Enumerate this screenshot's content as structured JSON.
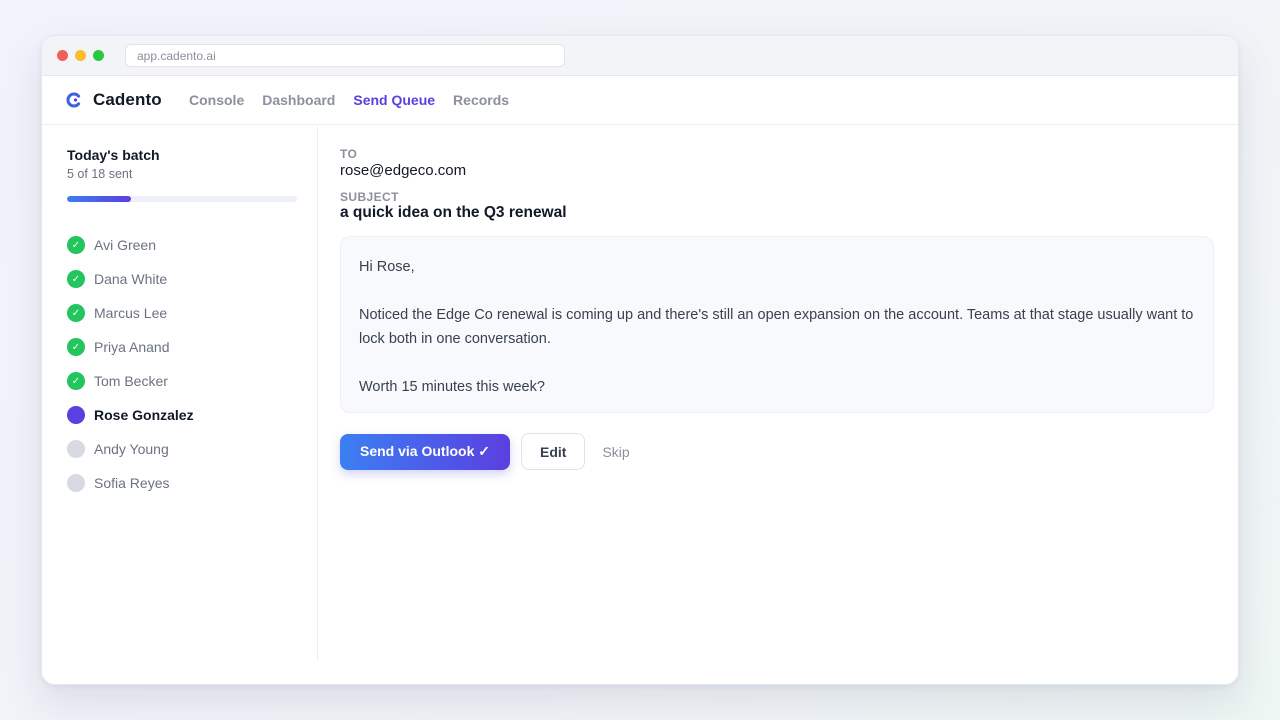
{
  "browser": {
    "url": "app.cadento.ai"
  },
  "app": {
    "name": "Cadento"
  },
  "nav": {
    "items": [
      {
        "label": "Console",
        "active": false
      },
      {
        "label": "Dashboard",
        "active": false
      },
      {
        "label": "Send Queue",
        "active": true
      },
      {
        "label": "Records",
        "active": false
      }
    ]
  },
  "batch": {
    "title": "Today's batch",
    "count_text": "5 of 18 sent",
    "progress_fraction": 0.278
  },
  "contacts": [
    {
      "name": "Avi Green",
      "status": "sent"
    },
    {
      "name": "Dana White",
      "status": "sent"
    },
    {
      "name": "Marcus Lee",
      "status": "sent"
    },
    {
      "name": "Priya Anand",
      "status": "sent"
    },
    {
      "name": "Tom Becker",
      "status": "sent"
    },
    {
      "name": "Rose Gonzalez",
      "status": "current"
    },
    {
      "name": "Andy Young",
      "status": "pending"
    },
    {
      "name": "Sofia Reyes",
      "status": "pending"
    }
  ],
  "email": {
    "to_label": "TO",
    "to": "rose@edgeco.com",
    "subject_label": "SUBJECT",
    "subject": "a quick idea on the Q3 renewal",
    "greeting": "Hi Rose,",
    "paragraph1": "Noticed the Edge Co renewal is coming up and there's still an open expansion on the account. Teams at that stage usually want to lock both in one conversation.",
    "paragraph2": "Worth 15 minutes this week?"
  },
  "actions": {
    "send_label": "Send via Outlook ✓",
    "edit_label": "Edit",
    "skip_label": "Skip"
  },
  "colors": {
    "accent": "#5b3fe0",
    "sent": "#22c55e",
    "pending": "#d7dae2"
  }
}
